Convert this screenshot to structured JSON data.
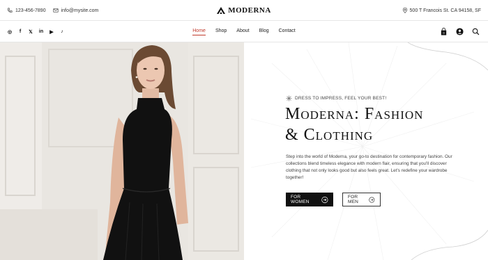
{
  "topbar": {
    "phone": "123-456-7890",
    "email": "info@mysite.com",
    "brand": "MODERNA",
    "address": "500 T Francois St. CA 94158, SF"
  },
  "socials": [
    {
      "icon": "instagram-icon",
      "glyph": "◎"
    },
    {
      "icon": "facebook-icon",
      "glyph": "f"
    },
    {
      "icon": "x-icon",
      "glyph": "𝕏"
    },
    {
      "icon": "linkedin-icon",
      "glyph": "in"
    },
    {
      "icon": "youtube-icon",
      "glyph": "▶"
    },
    {
      "icon": "tiktok-icon",
      "glyph": "♪"
    }
  ],
  "nav": {
    "items": [
      {
        "label": "Home",
        "active": true
      },
      {
        "label": "Shop",
        "active": false
      },
      {
        "label": "About",
        "active": false
      },
      {
        "label": "Blog",
        "active": false
      },
      {
        "label": "Contact",
        "active": false
      }
    ],
    "icons": [
      "shopping-bag-icon",
      "account-icon",
      "search-icon"
    ],
    "cart_count": "0"
  },
  "hero": {
    "tagline": "DRESS TO IMPRESS, FEEL YOUR BEST!",
    "headline_line1": "Moderna: Fashion",
    "headline_line2": "& Clothing",
    "description": "Step into the world of Moderna, your go-to destination for contemporary fashion. Our collections blend timeless elegance with modern flair, ensuring that you'll discover clothing that not only looks good but also feels great. Let's redefine your wardrobe together!",
    "button_women": "FOR WOMEN",
    "button_men": "FOR MEN"
  },
  "colors": {
    "accent": "#c0392b",
    "dark": "#111111",
    "photo_bg": "#e7e4df"
  }
}
